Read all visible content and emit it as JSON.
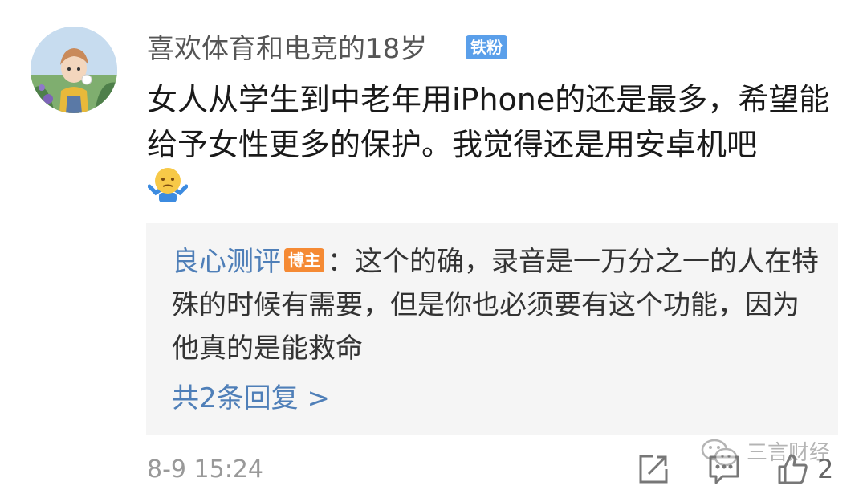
{
  "comment": {
    "username": "喜欢体育和电竞的18岁",
    "fan_badge": "铁粉",
    "body": "女人从学生到中老年用iPhone的还是最多，希望能给予女性更多的保护。我觉得还是用安卓机吧",
    "emoji": "shrug-emoji"
  },
  "reply": {
    "author": "良心测评",
    "author_badge": "博主",
    "separator": "：",
    "text": "这个的确，录音是一万分之一的人在特殊的时候有需要，但是你也必须要有这个功能，因为他真的是能救命",
    "more_label": "共2条回复 >"
  },
  "footer": {
    "timestamp": "8-9 15:24",
    "like_count": "2",
    "icons": [
      "share-icon",
      "comment-icon",
      "like-icon"
    ]
  },
  "watermark": {
    "text": "三言财经"
  },
  "colors": {
    "link_blue": "#4f7fb8",
    "fan_badge": "#5a9fea",
    "blogger_badge": "#f58a34",
    "reply_background": "#f5f5f5"
  }
}
